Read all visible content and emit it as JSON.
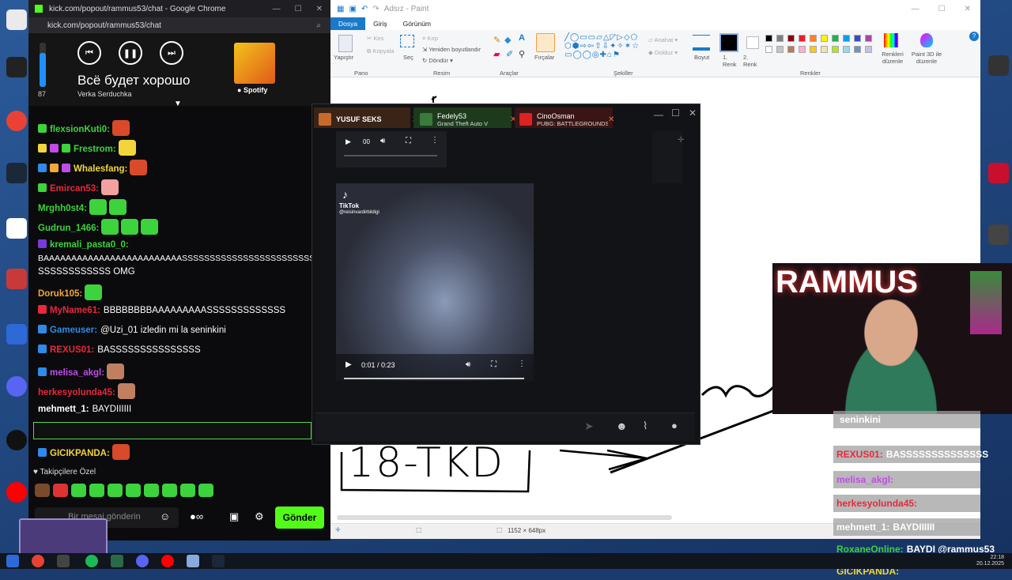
{
  "chrome": {
    "title": "kick.com/popout/rammus53/chat - Google Chrome",
    "url": "kick.com/popout/rammus53/chat"
  },
  "player": {
    "volume": 87,
    "volume_fraction": 0.76,
    "song": "Всё будет хорошо",
    "artist": "Verka Serduchka",
    "service": "Spotify"
  },
  "chat": {
    "messages": [
      {
        "user": "flexsionKuti0:",
        "text": "",
        "color": "#3cd33c"
      },
      {
        "user": "Frestrom:",
        "text": "",
        "color": "#3cd33c"
      },
      {
        "user": "Whalesfang:",
        "text": "",
        "color": "#f2d53c"
      },
      {
        "user": "Emircan53:",
        "text": "",
        "color": "#e8283c"
      },
      {
        "user": "Mrghh0st4:",
        "text": "",
        "color": "#3cd33c"
      },
      {
        "user": "Gudrun_1466:",
        "text": "",
        "color": "#3cd33c"
      },
      {
        "user": "kremali_pasta0_0:",
        "text": "",
        "color": "#3cd33c"
      },
      {
        "user": "Doruk105:",
        "text": "",
        "color": "#f2a63c"
      },
      {
        "user": "MyName61:",
        "text": "BBBBBBBBAAAAAAAAASSSSSSSSSSSSS",
        "color": "#e8283c"
      },
      {
        "user": "Gameuser:",
        "text": "@Uzi_01 izledin mi la seninkini",
        "color": "#2e8be8"
      },
      {
        "user": "REXUS01:",
        "text": "BASSSSSSSSSSSSSSS",
        "color": "#e8283c"
      },
      {
        "user": "melisa_akgl:",
        "text": "",
        "color": "#c04ce8"
      },
      {
        "user": "herkesyolunda45:",
        "text": "",
        "color": "#e8283c"
      },
      {
        "user": "mehmett_1:",
        "text": "BAYDIIIIII",
        "color": "#ffffff"
      },
      {
        "user": "RoxaneOnline:",
        "text": "BAYDI @rammus53",
        "color": "#3cd33c"
      },
      {
        "user": "GICIKPANDA:",
        "text": "",
        "color": "#f2d53c"
      }
    ],
    "long_line_1": "BAAAAAAAAAAAAAAAAAAAAAAAAASSSSSSSSSSSSSSSSSSSSSSSS",
    "long_line_2": "SSSSSSSSSSSS OMG",
    "followers_label": "Takipçilere Özel",
    "input_placeholder": "Bir mesaj gönderin",
    "send_label": "Gönder"
  },
  "paint": {
    "title": "Adsız - Paint",
    "tabs": [
      "Dosya",
      "Giriş",
      "Görünüm"
    ],
    "groups": [
      "Pano",
      "Resim",
      "Araçlar",
      "Şekiller",
      "Renkler"
    ],
    "paste": "Yapıştır",
    "cut": "Kes",
    "copy": "Kopyala",
    "select": "Seç",
    "crop": "Kırp",
    "resize": "Yeniden boyutlandır",
    "rotate": "Döndür",
    "brushes": "Fırçalar",
    "outline": "Anahat",
    "fill": "Dolduz",
    "size": "Boyut",
    "color1": "1. Renk",
    "color2": "2. Renk",
    "edit_colors": "Renkleri düzenle",
    "paint3d": "Paint 3D ile düzenle",
    "dimensions": "1152 × 648px",
    "canvas_text": "18-TKD"
  },
  "popup": {
    "tabs": [
      {
        "name": "YUSUF SEKS",
        "game": ""
      },
      {
        "name": "Fedely53",
        "game": "Grand Theft Auto V"
      },
      {
        "name": "CinoOsman",
        "game": "PUBG: BATTLEGROUNDS"
      }
    ],
    "small_time": "00",
    "tiktok": "TikTok",
    "tiktok_handle": "@reisinvardirbildigi",
    "time": "0:01 / 0:23"
  },
  "overlay": {
    "messages": [
      {
        "user": "",
        "text": "seninkini"
      },
      {
        "user": "REXUS01:",
        "text": "BASSSSSSSSSSSSSS"
      },
      {
        "user": "melisa_akgl:",
        "text": ""
      },
      {
        "user": "herkesyolunda45:",
        "text": ""
      },
      {
        "user": "mehmett_1:",
        "text": "BAYDIIIIII"
      },
      {
        "user": "RoxaneOnline:",
        "text": "BAYDI @rammus53"
      },
      {
        "user": "GICIKPANDA:",
        "text": ""
      }
    ],
    "cam_sign": "RAMMUS"
  },
  "taskbar": {
    "time": "22:18",
    "date": "20.12.2025"
  },
  "colors": {
    "kick_green": "#53fc18",
    "paint_blue": "#1979ca"
  }
}
